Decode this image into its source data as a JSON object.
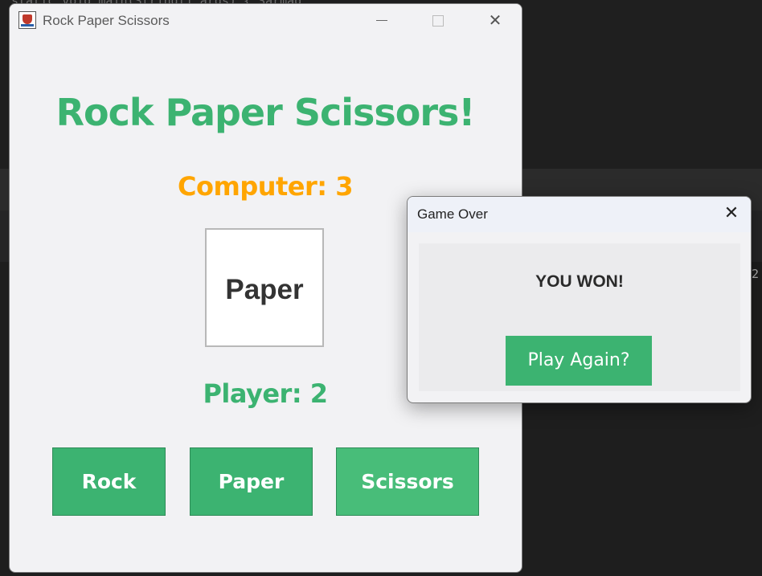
{
  "background": {
    "code_line": "static void main(String[] args) {    Sarmad",
    "line_number": "2"
  },
  "window": {
    "title": "Rock Paper Scissors",
    "min_icon": "minimize-icon",
    "max_icon": "maximize-icon",
    "close_icon": "close-icon",
    "close_glyph": "✕"
  },
  "game": {
    "heading": "Rock Paper Scissors!",
    "computer_score": "Computer: 3",
    "computer_choice": "Paper",
    "player_score": "Player: 2",
    "buttons": {
      "rock": "Rock",
      "paper": "Paper",
      "scissors": "Scissors"
    }
  },
  "dialog": {
    "title": "Game Over",
    "close_glyph": "✕",
    "message": "YOU WON!",
    "button": "Play Again?"
  },
  "colors": {
    "heading_green": "#3cb371",
    "computer_orange": "#ffa500",
    "button_green": "#3cb371"
  }
}
